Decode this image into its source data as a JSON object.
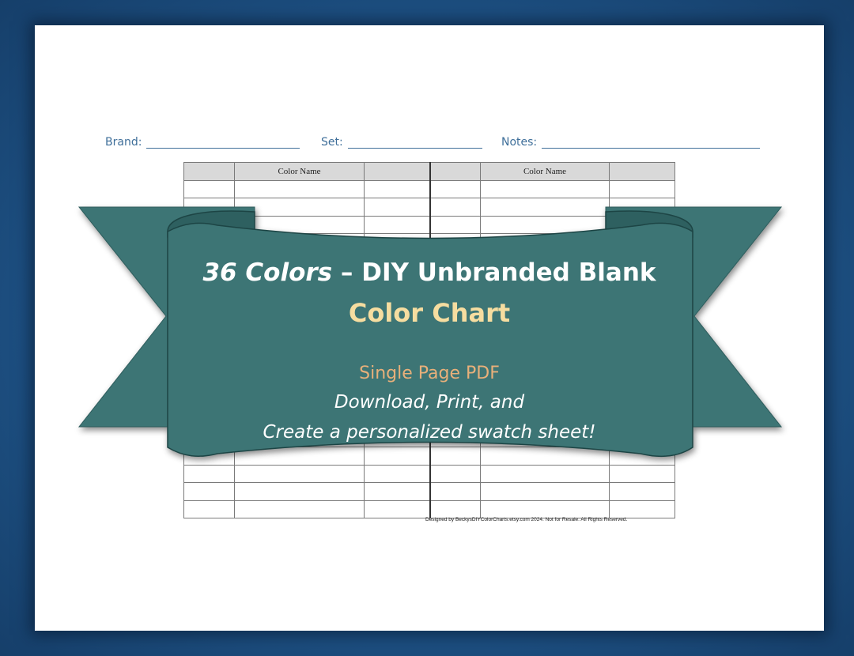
{
  "header": {
    "brand_label": "Brand:",
    "set_label": "Set:",
    "notes_label": "Notes:"
  },
  "table": {
    "column_header": "Color Name"
  },
  "credit": "Designed by BeckysDIYColorCharts.etsy.com 2024. Not for Resale. All Rights Reserved.",
  "banner": {
    "title_italic": "36 Colors",
    "title_rest": " – DIY Unbranded Blank",
    "subtitle": "Color Chart",
    "line1": "Single Page PDF",
    "line2": "Download, Print, and",
    "line3": "Create a personalized swatch sheet!"
  },
  "colors": {
    "background": "#1f5488",
    "banner_fill": "#3c7474",
    "header_text": "#3f6f9a",
    "subtitle": "#f6dda0",
    "single_page": "#e8b07a"
  }
}
